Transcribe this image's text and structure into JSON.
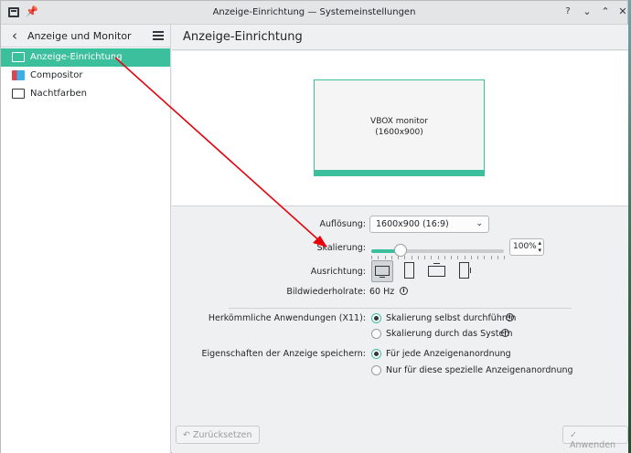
{
  "window": {
    "title": "Anzeige-Einrichtung — Systemeinstellungen",
    "pin_glyph": "📌",
    "help_glyph": "?",
    "minimize_glyph": "⌄",
    "maximize_glyph": "⌃",
    "close_glyph": "✕"
  },
  "sidebar": {
    "title": "Anzeige und Monitor",
    "back_glyph": "‹",
    "items": [
      {
        "label": "Anzeige-Einrichtung",
        "icon": "monitor-icon",
        "active": true
      },
      {
        "label": "Compositor",
        "icon": "compositor-icon",
        "active": false
      },
      {
        "label": "Nachtfarben",
        "icon": "monitor-icon",
        "active": false
      }
    ]
  },
  "main": {
    "title": "Anzeige-Einrichtung",
    "monitor_name": "VBOX monitor",
    "monitor_res": "(1600x900)",
    "resolution_label": "Auflösung:",
    "resolution_value": "1600x900 (16:9)",
    "resolution_arrow": "⌄",
    "scale_label": "Skalierung:",
    "scale_value": "100%",
    "scale_fraction": 0.22,
    "spin_glyph": "⌃⌄",
    "orientation_label": "Ausrichtung:",
    "refresh_label": "Bildwiederholrate:",
    "refresh_value": "60 Hz",
    "info_glyph": "i",
    "legacy_label": "Herkömmliche Anwendungen (X11):",
    "legacy_options": [
      "Skalierung selbst durchführen",
      "Skalierung durch das System"
    ],
    "save_label": "Eigenschaften der Anzeige speichern:",
    "save_options": [
      "Für jede Anzeigenanordnung",
      "Nur für diese spezielle Anzeigenanordnung"
    ]
  },
  "footer": {
    "reset_label": "Zurücksetzen",
    "reset_glyph": "↶",
    "apply_label": "Anwenden",
    "apply_glyph": "✓"
  },
  "colors": {
    "accent": "#3cbf9d",
    "annotation_arrow": "#e8000b"
  }
}
